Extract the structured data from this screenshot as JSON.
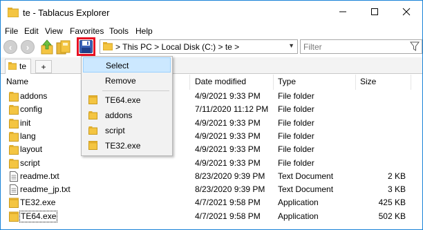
{
  "window": {
    "title": "te - Tablacus Explorer",
    "controls": {
      "minimize": "—",
      "maximize": "☐",
      "close": "✕"
    }
  },
  "menu": {
    "items": [
      "File",
      "Edit",
      "View",
      "Favorites",
      "Tools",
      "Help"
    ]
  },
  "toolbar": {
    "back_glyph": "‹",
    "forward_glyph": "›",
    "up_icon": "up-arrow-icon",
    "save_icon": "floppy-disk-icon"
  },
  "address": {
    "path": "> This PC > Local Disk (C:) > te >",
    "dropdown_glyph": "▼"
  },
  "filter": {
    "placeholder": "Filter"
  },
  "tabs": {
    "items": [
      {
        "label": "te"
      }
    ],
    "add_label": "+"
  },
  "columns": {
    "name": "Name",
    "date": "Date modified",
    "type": "Type",
    "size": "Size",
    "sort_glyph": "^"
  },
  "files": [
    {
      "name": "addons",
      "date": "4/9/2021 9:33 PM",
      "type": "File folder",
      "size": "",
      "icon": "folder-icon"
    },
    {
      "name": "config",
      "date": "7/11/2020 11:12 PM",
      "type": "File folder",
      "size": "",
      "icon": "folder-icon"
    },
    {
      "name": "init",
      "date": "4/9/2021 9:33 PM",
      "type": "File folder",
      "size": "",
      "icon": "folder-icon"
    },
    {
      "name": "lang",
      "date": "4/9/2021 9:33 PM",
      "type": "File folder",
      "size": "",
      "icon": "folder-icon"
    },
    {
      "name": "layout",
      "date": "4/9/2021 9:33 PM",
      "type": "File folder",
      "size": "",
      "icon": "folder-icon"
    },
    {
      "name": "script",
      "date": "4/9/2021 9:33 PM",
      "type": "File folder",
      "size": "",
      "icon": "folder-icon"
    },
    {
      "name": "readme.txt",
      "date": "8/23/2020 9:39 PM",
      "type": "Text Document",
      "size": "2 KB",
      "icon": "text-file-icon"
    },
    {
      "name": "readme_jp.txt",
      "date": "8/23/2020 9:39 PM",
      "type": "Text Document",
      "size": "3 KB",
      "icon": "text-file-icon"
    },
    {
      "name": "TE32.exe",
      "date": "4/7/2021 9:58 PM",
      "type": "Application",
      "size": "425 KB",
      "icon": "app-icon"
    },
    {
      "name": "TE64.exe",
      "date": "4/7/2021 9:58 PM",
      "type": "Application",
      "size": "502 KB",
      "icon": "app-icon"
    }
  ],
  "popup": {
    "items": [
      {
        "label": "Select",
        "icon": ""
      },
      {
        "label": "Remove",
        "icon": ""
      },
      {
        "label": "TE64.exe",
        "icon": "app-icon"
      },
      {
        "label": "addons",
        "icon": "folder-icon"
      },
      {
        "label": "script",
        "icon": "folder-icon"
      },
      {
        "label": "TE32.exe",
        "icon": "app-icon"
      }
    ]
  },
  "colors": {
    "accent_border": "#1883d7",
    "highlight": "#e81123",
    "menu_hover": "#cce8ff",
    "folder": "#f4c542"
  }
}
